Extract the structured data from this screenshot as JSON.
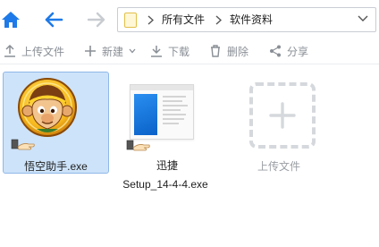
{
  "nav": {
    "home_icon": "home-icon",
    "back_icon": "arrow-left-icon",
    "forward_icon": "arrow-right-icon",
    "accent": "#1e7ae8"
  },
  "address": {
    "folder_icon": "folder-icon",
    "crumbs": [
      "所有文件",
      "软件资料"
    ],
    "dropdown_icon": "chevron-down-icon"
  },
  "toolbar": {
    "upload": "上传文件",
    "new": "新建",
    "download": "下载",
    "delete": "删除",
    "share": "分享"
  },
  "files": [
    {
      "name": "悟空助手.exe",
      "selected": true,
      "icon": "monkey-app-icon",
      "shortcut": true
    },
    {
      "name_line1": "迅捷",
      "name_line2": "Setup_14-4-4.exe",
      "selected": false,
      "icon": "window-thumbnail",
      "shortcut": true
    }
  ],
  "upload_tile": {
    "label": "上传文件",
    "icon": "plus-icon"
  },
  "colors": {
    "selection_bg": "#cde3f9",
    "selection_border": "#8fb8e8",
    "disabled_text": "#8a8f96"
  }
}
